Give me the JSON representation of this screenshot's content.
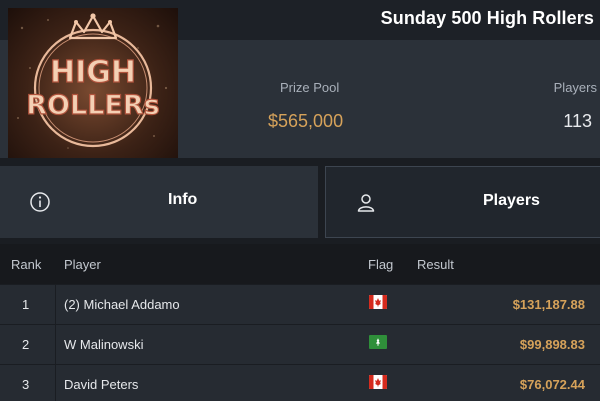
{
  "header": {
    "title": "Sunday 500 High Rollers"
  },
  "logo": {
    "line1": "HIGH",
    "line2": "ROLLERs"
  },
  "stats": {
    "prize_pool_label": "Prize Pool",
    "prize_pool_value": "$565,000",
    "players_label": "Players",
    "players_value": "113"
  },
  "tabs": {
    "info_label": "Info",
    "players_label": "Players",
    "info_icon": "info-circle-icon",
    "players_icon": "user-icon",
    "active": "Players"
  },
  "table": {
    "headers": {
      "rank": "Rank",
      "player": "Player",
      "flag": "Flag",
      "result": "Result"
    },
    "rows": [
      {
        "rank": "1",
        "player": "(2) Michael Addamo",
        "flag": "canada-flag-icon",
        "result": "$131,187.88"
      },
      {
        "rank": "2",
        "player": "W Malinowski",
        "flag": "green-flag-icon",
        "result": "$99,898.83"
      },
      {
        "rank": "3",
        "player": "David Peters",
        "flag": "canada-flag-icon",
        "result": "$76,072.44"
      }
    ]
  },
  "colors": {
    "accent_gold": "#d6a25a",
    "panel": "#2b3139",
    "row": "#262b32"
  }
}
